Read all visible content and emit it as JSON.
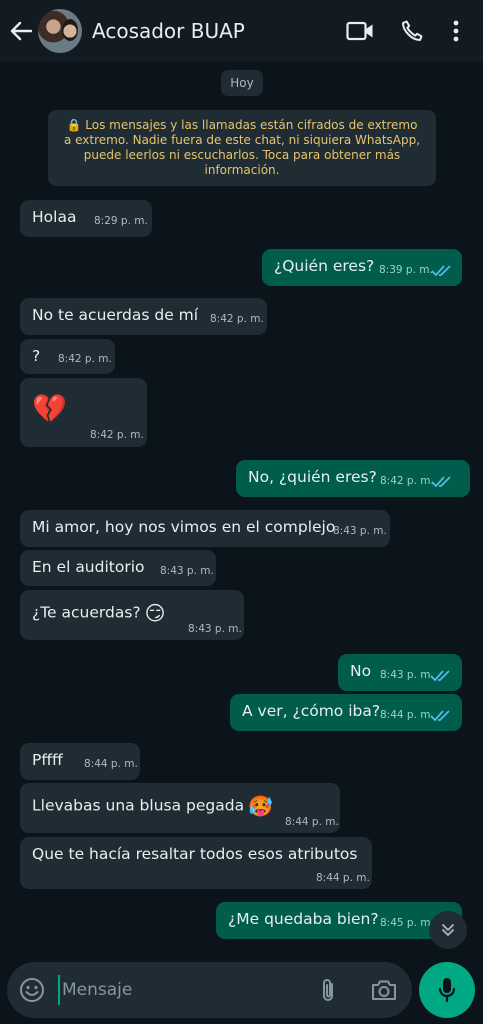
{
  "header": {
    "contact_name": "Acosador BUAP",
    "icons": [
      "arrow-left-icon",
      "avatar",
      "video-call-icon",
      "phone-icon",
      "more-vert-icon"
    ]
  },
  "chat": {
    "date_label": "Hoy",
    "encryption_notice": "🔒 Los mensajes y las llamadas están cifrados de extremo a extremo. Nadie fuera de este chat, ni siquiera WhatsApp, puede leerlos ni escucharlos. Toca para obtener más información.",
    "messages": [
      {
        "direction": "incoming",
        "text": "Holaa",
        "time": "8:29 p. m."
      },
      {
        "direction": "outgoing",
        "text": "¿Quién eres?",
        "time": "8:39 p. m.",
        "status": "read"
      },
      {
        "direction": "incoming",
        "text": "No te acuerdas de mí",
        "time": "8:42 p. m."
      },
      {
        "direction": "incoming",
        "text": "?",
        "time": "8:42 p. m."
      },
      {
        "direction": "incoming",
        "text": "💔",
        "time": "8:42 p. m."
      },
      {
        "direction": "outgoing",
        "text": "No, ¿quién eres?",
        "time": "8:42 p. m.",
        "status": "read"
      },
      {
        "direction": "incoming",
        "text": "Mi amor, hoy nos vimos en el complejo",
        "time": "8:43 p. m."
      },
      {
        "direction": "incoming",
        "text": "En el auditorio",
        "time": "8:43 p. m."
      },
      {
        "direction": "incoming",
        "text": "¿Te acuerdas?",
        "emoji": "😏",
        "time": "8:43 p. m."
      },
      {
        "direction": "outgoing",
        "text": "No",
        "time": "8:43 p. m.",
        "status": "read"
      },
      {
        "direction": "outgoing",
        "text": "A ver, ¿cómo iba?",
        "time": "8:44 p. m.",
        "status": "read"
      },
      {
        "direction": "incoming",
        "text": "Pffff",
        "time": "8:44 p. m."
      },
      {
        "direction": "incoming",
        "text": "Llevabas una blusa pegada",
        "emoji": "🥵",
        "time": "8:44 p. m."
      },
      {
        "direction": "incoming",
        "text": "Que te hacía resaltar todos esos atributos",
        "time": "8:44 p. m."
      },
      {
        "direction": "outgoing",
        "text": "¿Me quedaba bien?",
        "time": "8:45 p. m.",
        "status": "read"
      }
    ]
  },
  "composer": {
    "placeholder": "Mensaje"
  },
  "colors": {
    "background": "#0b141a",
    "header": "#111b21",
    "incoming_bubble": "#202c33",
    "outgoing_bubble": "#005c4b",
    "accent": "#00a884",
    "read_ticks": "#53bdeb",
    "notice_text": "#e6c46d"
  }
}
